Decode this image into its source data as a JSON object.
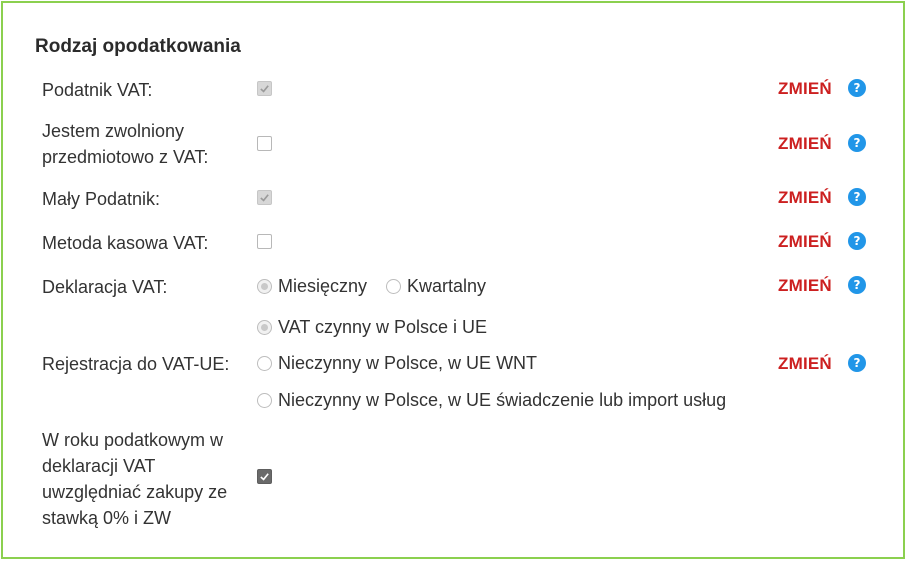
{
  "section": {
    "title": "Rodzaj opodatkowania"
  },
  "rows": [
    {
      "label": "Podatnik VAT:",
      "checked": true,
      "disabled": true,
      "change": "ZMIEŃ",
      "help": "?"
    },
    {
      "label_line1": "Jestem zwolniony",
      "label_line2": "przedmiotowo z VAT:",
      "checked": false,
      "disabled": true,
      "change": "ZMIEŃ",
      "help": "?"
    },
    {
      "label": "Mały Podatnik:",
      "checked": true,
      "disabled": true,
      "change": "ZMIEŃ",
      "help": "?"
    },
    {
      "label": "Metoda kasowa VAT:",
      "checked": false,
      "disabled": true,
      "change": "ZMIEŃ",
      "help": "?"
    }
  ],
  "declaration": {
    "label": "Deklaracja VAT:",
    "options": [
      {
        "text": "Miesięczny",
        "selected": true
      },
      {
        "text": "Kwartalny",
        "selected": false
      }
    ],
    "change": "ZMIEŃ",
    "help": "?"
  },
  "registration": {
    "label": "Rejestracja do VAT-UE:",
    "options": [
      {
        "text": "VAT czynny w Polsce i UE",
        "selected": true
      },
      {
        "text": "Nieczynny w Polsce, w UE WNT",
        "selected": false
      },
      {
        "text": "Nieczynny w Polsce, w UE świadczenie lub import usług",
        "selected": false
      }
    ],
    "change": "ZMIEŃ",
    "help": "?"
  },
  "purchases": {
    "label_lines": [
      "W roku podatkowym w",
      "deklaracji VAT",
      "uwzględniać zakupy ze",
      "stawką 0% i ZW"
    ],
    "checked": true,
    "disabled": false
  },
  "colors": {
    "panel_border": "#8bd04f",
    "change_link": "#cc2020",
    "help_icon": "#2196e8"
  }
}
